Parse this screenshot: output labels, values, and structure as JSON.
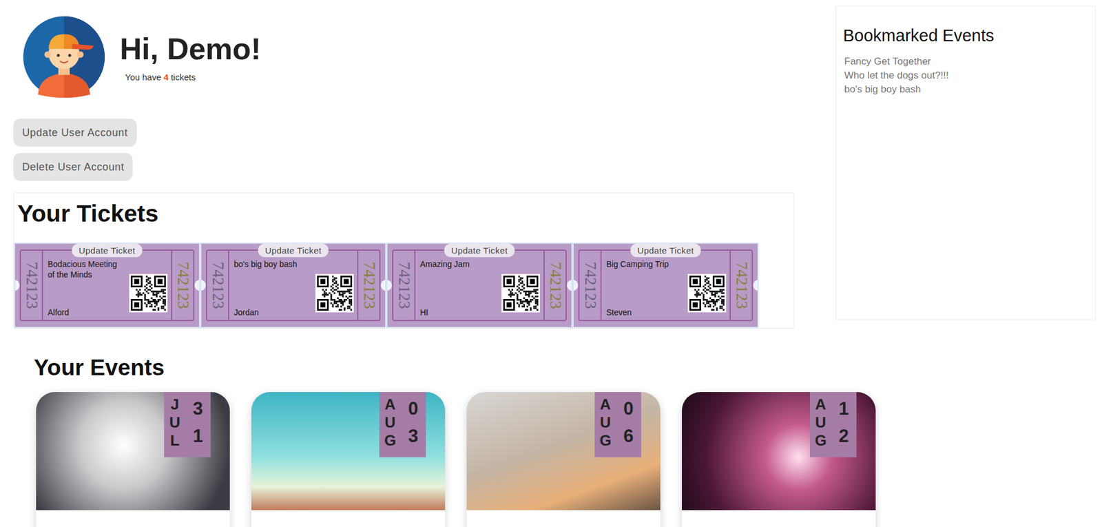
{
  "user": {
    "greeting": "Hi, Demo!",
    "ticket_prefix": "You have",
    "ticket_count": "4",
    "ticket_suffix": "tickets"
  },
  "account_buttons": [
    "Update User Account",
    "Delete User Account"
  ],
  "tickets": {
    "title": "Your Tickets",
    "items": [
      {
        "event": "Bodacious Meeting of the Minds",
        "holder": "Alford",
        "serial": "742123",
        "button": "Update Ticket"
      },
      {
        "event": "bo's big boy bash",
        "holder": "Jordan",
        "serial": "742123",
        "button": "Update Ticket"
      },
      {
        "event": "Amazing Jam",
        "holder": "HI",
        "serial": "742123",
        "button": "Update Ticket"
      },
      {
        "event": "Big Camping Trip",
        "holder": "Steven",
        "serial": "742123",
        "button": "Update Ticket"
      }
    ]
  },
  "bookmarks": {
    "title": "Bookmarked Events",
    "items": [
      "Fancy Get Together",
      "Who let the dogs out?!!!",
      "bo's big boy bash"
    ]
  },
  "events": {
    "title": "Your Events",
    "items": [
      {
        "month": "JUL",
        "day": "31"
      },
      {
        "month": "AUG",
        "day": "03"
      },
      {
        "month": "AUG",
        "day": "06"
      },
      {
        "month": "AUG",
        "day": "12"
      }
    ]
  }
}
